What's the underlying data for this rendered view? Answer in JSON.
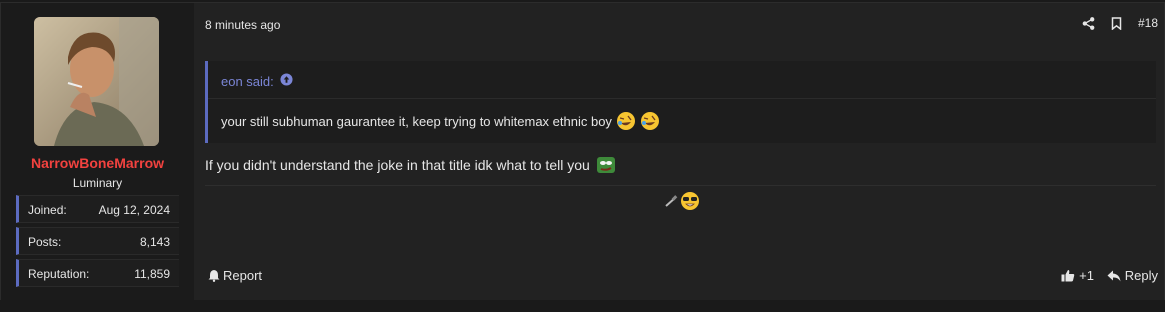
{
  "user": {
    "name": "NarrowBoneMarrow",
    "title": "Luminary",
    "stats": [
      {
        "key": "Joined:",
        "value": "Aug 12, 2024"
      },
      {
        "key": "Posts:",
        "value": "8,143"
      },
      {
        "key": "Reputation:",
        "value": "11,859"
      }
    ]
  },
  "post": {
    "time": "8 minutes ago",
    "number": "#18",
    "quote": {
      "author": "eon said:",
      "text": "your still subhuman gaurantee it, keep trying to whitemax ethnic boy"
    },
    "message": "If you didn't understand the joke in that title idk what to tell you",
    "report_label": "Report",
    "reaction_count": "+1",
    "reply_label": "Reply"
  },
  "colors": {
    "username": "#f2423f",
    "accent": "#5c6bc0",
    "quote_author": "#7b86d6"
  },
  "icons": [
    "share-icon",
    "bookmark-icon",
    "arrow-up-circle-icon",
    "bell-icon",
    "thumbs-up-icon",
    "reply-icon"
  ]
}
